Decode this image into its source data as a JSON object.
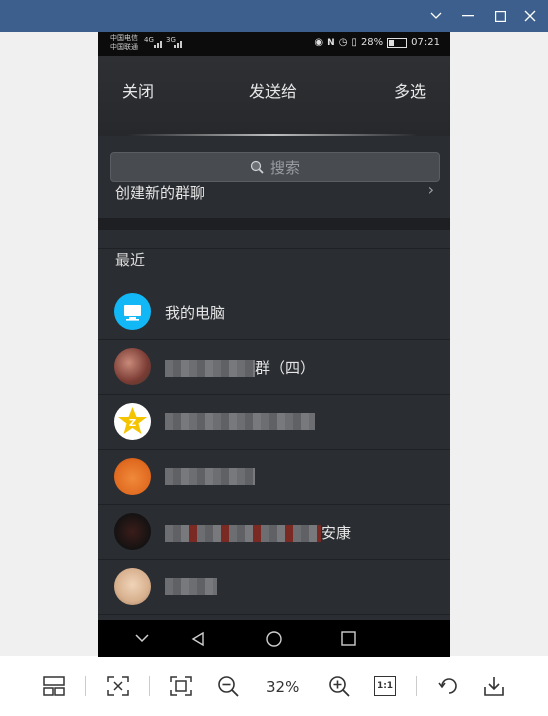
{
  "window": {
    "controls": {
      "collapse": "chevron-down-icon",
      "restore": "restore-icon",
      "maximize": "maximize-icon",
      "close": "close-icon"
    }
  },
  "status_bar": {
    "carrier_1": "中国电信",
    "carrier_2": "中国联通",
    "signal_1": "4G",
    "signal_2": "3G",
    "battery_percent": "28%",
    "battery_level": 0.28,
    "time": "07:21"
  },
  "header": {
    "close_label": "关闭",
    "title": "发送给",
    "multi_select_label": "多选"
  },
  "search": {
    "placeholder": "搜索"
  },
  "create_group": {
    "label": "创建新的群聊",
    "chevron": "›"
  },
  "recent": {
    "section_label": "最近",
    "contacts": [
      {
        "name": "我的电脑",
        "avatar": "computer-icon",
        "avatar_color": "#12b7f5"
      },
      {
        "name_suffix": "群（四）",
        "avatar": "photo"
      },
      {
        "name_suffix": "",
        "avatar": "qzone-icon",
        "avatar_color": "#f5c400"
      },
      {
        "name_suffix": "",
        "avatar": "photo-orange"
      },
      {
        "name_suffix": "安康",
        "avatar": "photo-dark"
      },
      {
        "name_suffix": "",
        "avatar": "photo-light"
      }
    ]
  },
  "nav_bar": {
    "back": "▽",
    "back_icon": "back-triangle-icon",
    "home": "○",
    "recents": "□"
  },
  "viewer_toolbar": {
    "zoom_level": "32%",
    "actual_size_label": "1:1",
    "buttons": [
      "layout-icon",
      "fit-icon",
      "fullscreen-icon",
      "zoom-out-icon",
      "zoom-in-icon",
      "actual-size-icon",
      "rotate-icon",
      "save-icon"
    ]
  },
  "colors": {
    "title_bar": "#3c5f8d",
    "app_background": "#2a2d31",
    "accent_blue": "#12b7f5"
  }
}
